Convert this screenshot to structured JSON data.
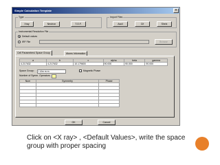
{
  "window": {
    "title": "Simple Calculation Template",
    "close_glyph": "×"
  },
  "type_group": {
    "title": "Type",
    "buttons": [
      "Xray",
      "Neutron",
      "T.O.F."
    ]
  },
  "import_group": {
    "title": "Import Files",
    "buttons": [
      "Ascii",
      "Cif",
      "Shelx"
    ]
  },
  "resolution_group": {
    "title": "Instrumental Resolution File",
    "options": [
      "Default values",
      "IRF File"
    ],
    "selected": "Default values",
    "browse_label": "Browse"
  },
  "tabs": [
    "Cell Parameters/ Space Group",
    "Atoms Information"
  ],
  "cell_table": {
    "headers": [
      "a",
      "b",
      "c",
      "alpha",
      "beta",
      "gamma"
    ],
    "values": [
      "4.217632",
      "4.217632",
      "10.179600",
      "90.000",
      "90.000",
      "90.000"
    ]
  },
  "space_group": {
    "label": "Space Group:",
    "value": "I 4/m m m",
    "magnetic_label": "Magnetic Phase"
  },
  "symmetry": {
    "label": "Number of Symm. Operators",
    "headers": [
      "Num",
      "Symmetry",
      "Phase"
    ]
  },
  "footer": {
    "ok_label": "OK",
    "cancel_label": "Cancel"
  },
  "caption": "Click on <X ray> , <Default Values>, write the space group with proper spacing",
  "colors": {
    "titlebar_start": "#0a246a",
    "titlebar_end": "#a6caf0",
    "dialog_bg": "#d4d0c8",
    "accent_circle": "#e8802a"
  }
}
